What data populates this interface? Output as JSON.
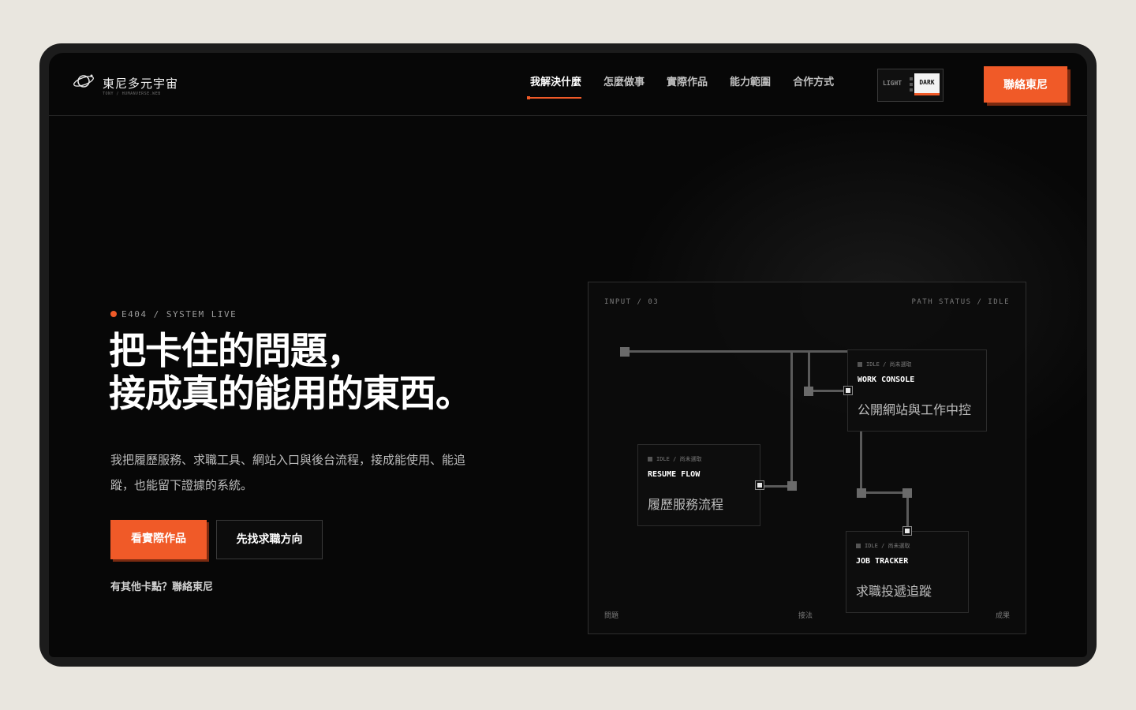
{
  "brand": {
    "title": "東尼多元宇宙",
    "subtitle": "TONY / HUMANVERSE.WEB"
  },
  "nav": {
    "items": [
      "我解決什麼",
      "怎麼做事",
      "實際作品",
      "能力範圍",
      "合作方式"
    ],
    "active_index": 0
  },
  "theme_toggle": {
    "light_label": "LIGHT",
    "dark_label": "DARK",
    "selected": "DARK"
  },
  "header_contact": "聯絡東尼",
  "hero": {
    "status": "E404 / SYSTEM LIVE",
    "title_line1": "把卡住的問題，",
    "title_line2": "接成真的能用的東西。",
    "description": "我把履歷服務、求職工具、網站入口與後台流程，接成能使用、能追蹤，也能留下證據的系統。",
    "primary_button": "看實際作品",
    "secondary_button": "先找求職方向",
    "contact_link": "有其他卡點？聯絡東尼"
  },
  "diagram": {
    "input_label": "INPUT / 03",
    "path_status": "PATH STATUS / IDLE",
    "nodes": [
      {
        "status": "IDLE / 尚未選取",
        "code": "WORK CONSOLE",
        "name": "公開網站與工作中控"
      },
      {
        "status": "IDLE / 尚未選取",
        "code": "RESUME FLOW",
        "name": "履歷服務流程"
      },
      {
        "status": "IDLE / 尚未選取",
        "code": "JOB TRACKER",
        "name": "求職投遞追蹤"
      }
    ],
    "footer": [
      "問題",
      "接法",
      "成果"
    ]
  },
  "colors": {
    "accent": "#f05a28",
    "background": "#070707",
    "frame": "#1c1c1c",
    "page": "#e9e6df"
  }
}
